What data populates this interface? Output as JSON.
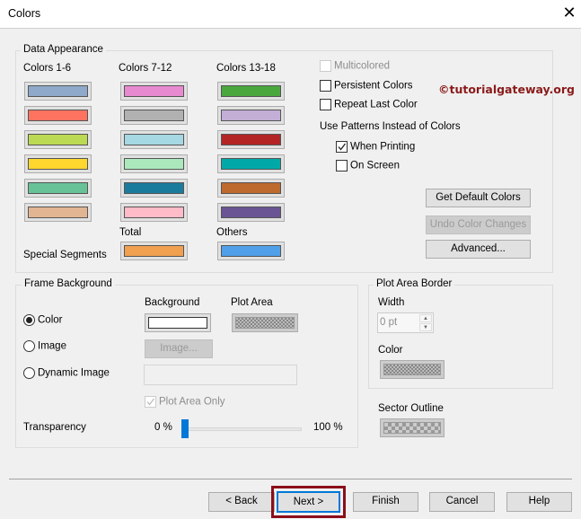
{
  "window": {
    "title": "Colors",
    "close_icon": "close-icon"
  },
  "watermark": "©tutorialgateway.org",
  "data_appearance": {
    "legend": "Data Appearance",
    "columns": [
      {
        "label": "Colors 1-6",
        "colors": [
          "#8ea9c9",
          "#fd7360",
          "#bcd953",
          "#ffd72e",
          "#67c397",
          "#e2b592"
        ]
      },
      {
        "label": "Colors 7-12",
        "colors": [
          "#e78ad0",
          "#b1b1b1",
          "#a5d8e3",
          "#abe9bd",
          "#1b7b9c",
          "#ffbbc8"
        ]
      },
      {
        "label": "Colors 13-18",
        "colors": [
          "#4aa73e",
          "#c3aed6",
          "#b32524",
          "#00a9a7",
          "#be692e",
          "#6b5494"
        ]
      }
    ],
    "special_segments_label": "Special Segments",
    "total": {
      "label": "Total",
      "color": "#f0a04e"
    },
    "others": {
      "label": "Others",
      "color": "#4f9fe9"
    },
    "multicolored": {
      "label": "Multicolored",
      "checked": false,
      "disabled": true
    },
    "persistent_colors": {
      "label": "Persistent Colors",
      "checked": false
    },
    "repeat_last_color": {
      "label": "Repeat Last Color",
      "checked": false
    },
    "use_patterns_label": "Use Patterns Instead of Colors",
    "when_printing": {
      "label": "When Printing",
      "checked": true
    },
    "on_screen": {
      "label": "On Screen",
      "checked": false
    },
    "get_default_colors": "Get Default Colors",
    "undo_color_changes": "Undo Color Changes",
    "advanced": "Advanced..."
  },
  "frame_background": {
    "legend": "Frame Background",
    "background_label": "Background",
    "plot_area_label": "Plot Area",
    "options": [
      {
        "label": "Color",
        "selected": true
      },
      {
        "label": "Image",
        "selected": false
      },
      {
        "label": "Dynamic Image",
        "selected": false
      }
    ],
    "image_button": "Image...",
    "dynamic_image_value": "",
    "plot_area_only": {
      "label": "Plot Area Only",
      "checked": true,
      "disabled": true
    },
    "transparency_label": "Transparency",
    "transparency_min": "0 %",
    "transparency_max": "100 %",
    "transparency_value": 0
  },
  "plot_area_border": {
    "legend": "Plot Area Border",
    "width_label": "Width",
    "width_value": "0 pt",
    "color_label": "Color"
  },
  "sector_outline_label": "Sector Outline",
  "footer": {
    "back": "< Back",
    "next": "Next >",
    "finish": "Finish",
    "cancel": "Cancel",
    "help": "Help",
    "highlight_color": "#8b0e1a"
  }
}
